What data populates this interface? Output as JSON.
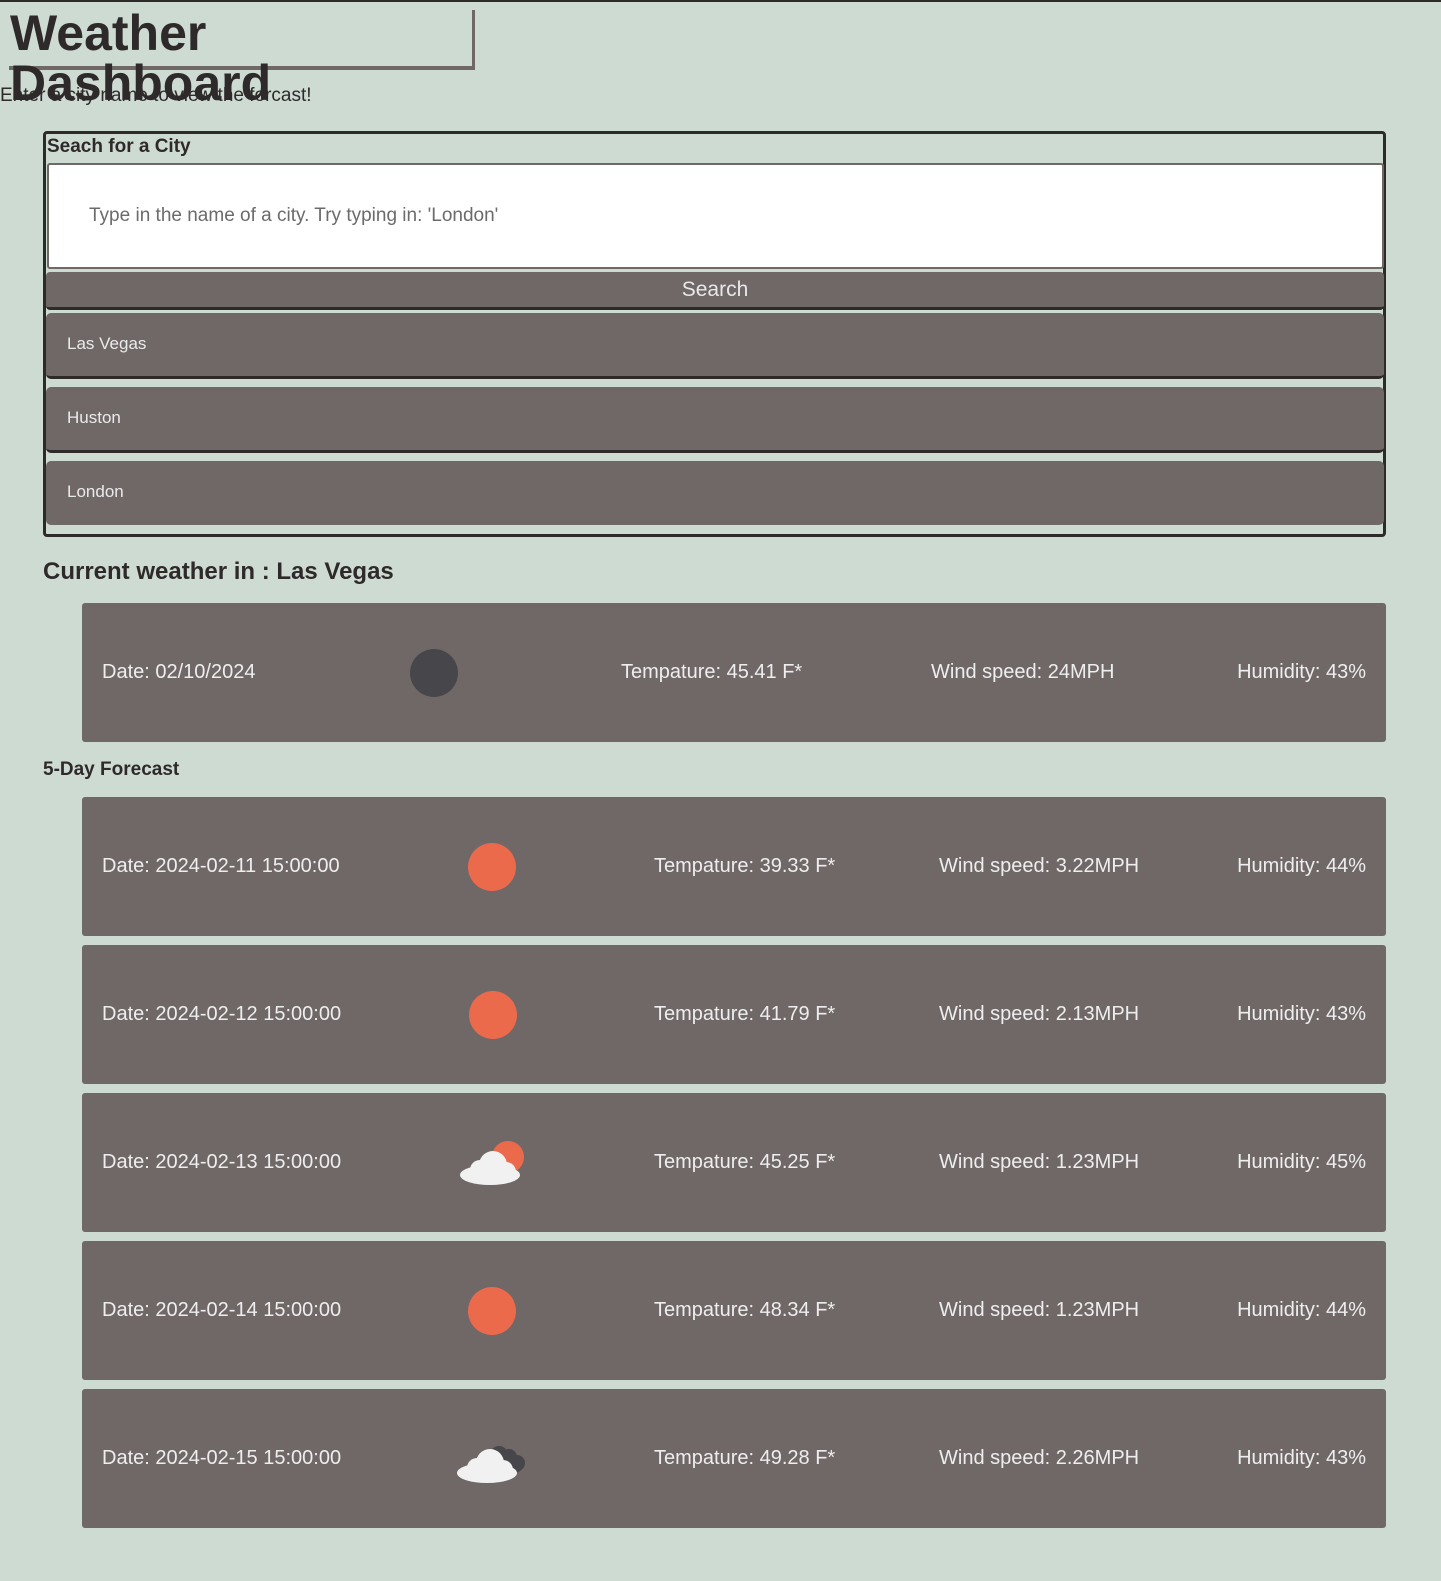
{
  "header": {
    "title": "Weather Dashboard",
    "subtitle": "Enter a city name to view the forcast!"
  },
  "search": {
    "label": "Seach for a City",
    "placeholder": "Type in the name of a city. Try typing in: 'London'",
    "value": "",
    "button_label": "Search",
    "history": [
      "Las Vegas",
      "Huston",
      "London"
    ]
  },
  "current": {
    "heading": "Current weather in : Las Vegas",
    "date": "Date: 02/10/2024",
    "icon": "moon-clear-night-icon",
    "temperature": "Tempature: 45.41 F*",
    "wind": "Wind speed: 24MPH",
    "humidity": "Humidity: 43%"
  },
  "forecast": {
    "heading": "5-Day Forecast",
    "days": [
      {
        "date": "Date: 2024-02-11 15:00:00",
        "icon": "sun-icon",
        "temperature": "Tempature: 39.33 F*",
        "wind": "Wind speed: 3.22MPH",
        "humidity": "Humidity: 44%"
      },
      {
        "date": "Date: 2024-02-12 15:00:00",
        "icon": "sun-icon",
        "temperature": "Tempature: 41.79 F*",
        "wind": "Wind speed: 2.13MPH",
        "humidity": "Humidity: 43%"
      },
      {
        "date": "Date: 2024-02-13 15:00:00",
        "icon": "partly-cloudy-icon",
        "temperature": "Tempature: 45.25 F*",
        "wind": "Wind speed: 1.23MPH",
        "humidity": "Humidity: 45%"
      },
      {
        "date": "Date: 2024-02-14 15:00:00",
        "icon": "sun-icon",
        "temperature": "Tempature: 48.34 F*",
        "wind": "Wind speed: 1.23MPH",
        "humidity": "Humidity: 44%"
      },
      {
        "date": "Date: 2024-02-15 15:00:00",
        "icon": "broken-clouds-icon",
        "temperature": "Tempature: 49.28 F*",
        "wind": "Wind speed: 2.26MPH",
        "humidity": "Humidity: 43%"
      }
    ]
  },
  "colors": {
    "background": "#cddbd2",
    "card": "#706867",
    "text_dark": "#2f2a2a",
    "sun": "#ec6a4c",
    "moon": "#47464a",
    "cloud_light": "#f1f1f1",
    "cloud_dark": "#47464a"
  }
}
